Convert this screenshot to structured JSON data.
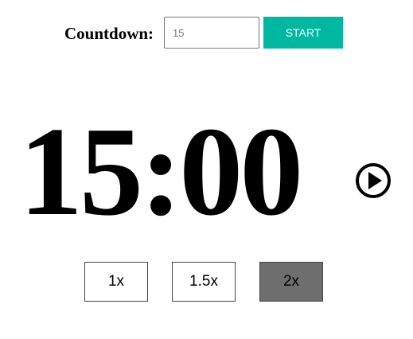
{
  "header": {
    "label": "Countdown:",
    "input_value": "15",
    "start_label": "START"
  },
  "timer": {
    "display": "15:00"
  },
  "icons": {
    "play": "play-circle-icon"
  },
  "speeds": [
    {
      "label": "1x",
      "active": false
    },
    {
      "label": "1.5x",
      "active": false
    },
    {
      "label": "2x",
      "active": true
    }
  ],
  "colors": {
    "accent": "#00b7a0",
    "active_speed": "#6e6e6e"
  }
}
